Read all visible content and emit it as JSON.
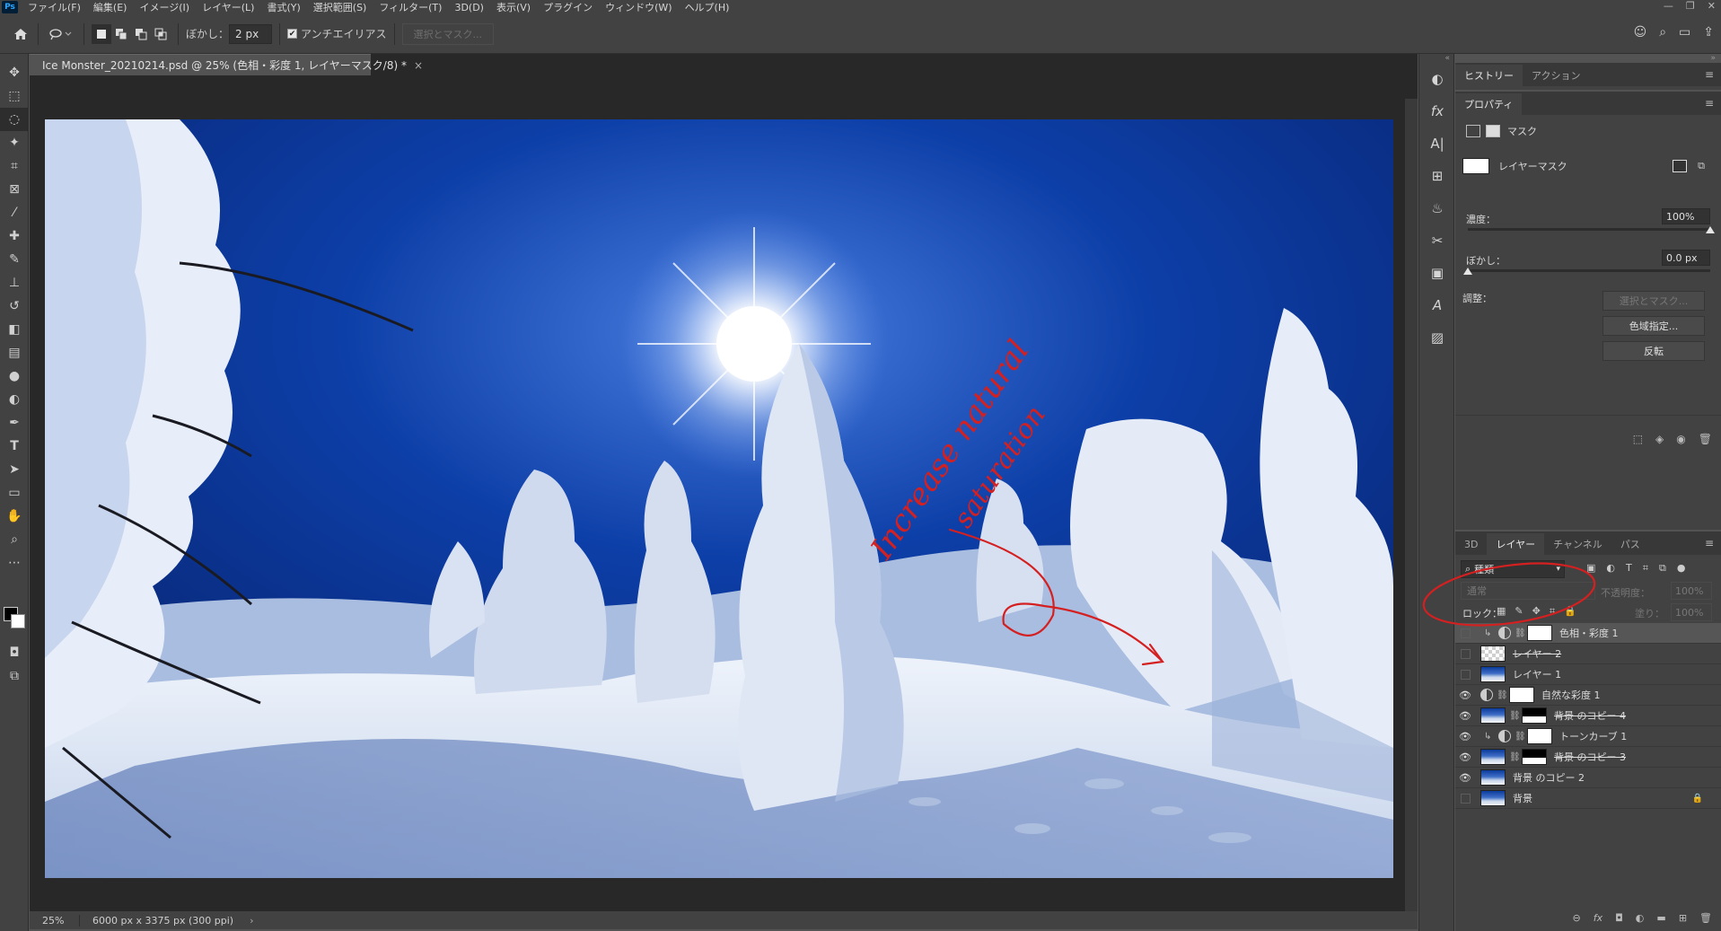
{
  "app": {
    "logo": "Ps"
  },
  "menubar": {
    "items": [
      "ファイル(F)",
      "編集(E)",
      "イメージ(I)",
      "レイヤー(L)",
      "書式(Y)",
      "選択範囲(S)",
      "フィルター(T)",
      "3D(D)",
      "表示(V)",
      "プラグイン",
      "ウィンドウ(W)",
      "ヘルプ(H)"
    ],
    "window_controls": [
      "—",
      "❐",
      "✕"
    ]
  },
  "optionsbar": {
    "feather_label": "ぼかし：",
    "feather_value": "2 px",
    "antialias_label": "アンチエイリアス",
    "antialias_checked": true,
    "select_mask_label": "選択とマスク..."
  },
  "document": {
    "tab_title": "Ice Monster_20210214.psd @ 25% (色相・彩度 1, レイヤーマスク/8) *",
    "zoom": "25%",
    "info": "6000 px x 3375 px (300 ppi)"
  },
  "annotation": {
    "text_line1": "Increase natural",
    "text_line2": "saturation",
    "color": "#d42020"
  },
  "history_panel": {
    "tabs": [
      "ヒストリー",
      "アクション"
    ]
  },
  "properties_panel": {
    "title": "プロパティ",
    "mask_tab_label": "マスク",
    "layer_mask_label": "レイヤーマスク",
    "density_label": "濃度：",
    "density_value": "100%",
    "density_fraction": 1.0,
    "feather_label": "ぼかし：",
    "feather_value": "0.0 px",
    "feather_fraction": 0.0,
    "adjust_label": "調整：",
    "select_mask_button": "選択とマスク...",
    "color_range_button": "色域指定...",
    "invert_button": "反転"
  },
  "layers_panel": {
    "tabs": [
      "3D",
      "レイヤー",
      "チャンネル",
      "パス"
    ],
    "filter_label": "種類",
    "blend_mode": "通常",
    "opacity_label": "不透明度：",
    "opacity_value": "100%",
    "lock_label": "ロック：",
    "fill_label": "塗り：",
    "fill_value": "100%",
    "layers": [
      {
        "name": "色相・彩度 1",
        "visible": false,
        "selected": true,
        "clip": true,
        "adjust": true,
        "chain": true,
        "thumb": "white",
        "strike": false,
        "locked": false
      },
      {
        "name": "レイヤー 2",
        "visible": false,
        "selected": false,
        "clip": false,
        "adjust": false,
        "chain": false,
        "thumb": "checker",
        "strike": true,
        "locked": false
      },
      {
        "name": "レイヤー 1",
        "visible": false,
        "selected": false,
        "clip": false,
        "adjust": false,
        "chain": false,
        "thumb": "photo",
        "strike": false,
        "locked": false
      },
      {
        "name": "自然な彩度 1",
        "visible": true,
        "selected": false,
        "clip": false,
        "adjust": true,
        "chain": true,
        "thumb": "white",
        "strike": false,
        "locked": false
      },
      {
        "name": "背景 のコピー 4",
        "visible": true,
        "selected": false,
        "clip": false,
        "adjust": false,
        "chain": true,
        "thumb": "photo",
        "mask": true,
        "strike": true,
        "locked": false
      },
      {
        "name": "トーンカーブ 1",
        "visible": true,
        "selected": false,
        "clip": true,
        "adjust": true,
        "chain": true,
        "thumb": "white",
        "strike": false,
        "locked": false
      },
      {
        "name": "背景 のコピー 3",
        "visible": true,
        "selected": false,
        "clip": false,
        "adjust": false,
        "chain": true,
        "thumb": "photo",
        "mask": true,
        "strike": true,
        "locked": false
      },
      {
        "name": "背景 のコピー 2",
        "visible": true,
        "selected": false,
        "clip": false,
        "adjust": false,
        "chain": false,
        "thumb": "photo",
        "strike": false,
        "locked": false
      },
      {
        "name": "背景",
        "visible": false,
        "selected": false,
        "clip": false,
        "adjust": false,
        "chain": false,
        "thumb": "photo",
        "strike": false,
        "locked": true
      }
    ],
    "footer_icons": [
      "link-icon",
      "fx-icon",
      "mask-icon",
      "adjustment-icon",
      "folder-icon",
      "new-layer-icon",
      "trash-icon"
    ]
  },
  "colors": {
    "ui_dark": "#424242",
    "ui_mid": "#535353",
    "canvas_bg": "#282828",
    "sky_top": "#061a5c",
    "sky_mid": "#0d3fa8",
    "annotation_red": "#d42020"
  }
}
